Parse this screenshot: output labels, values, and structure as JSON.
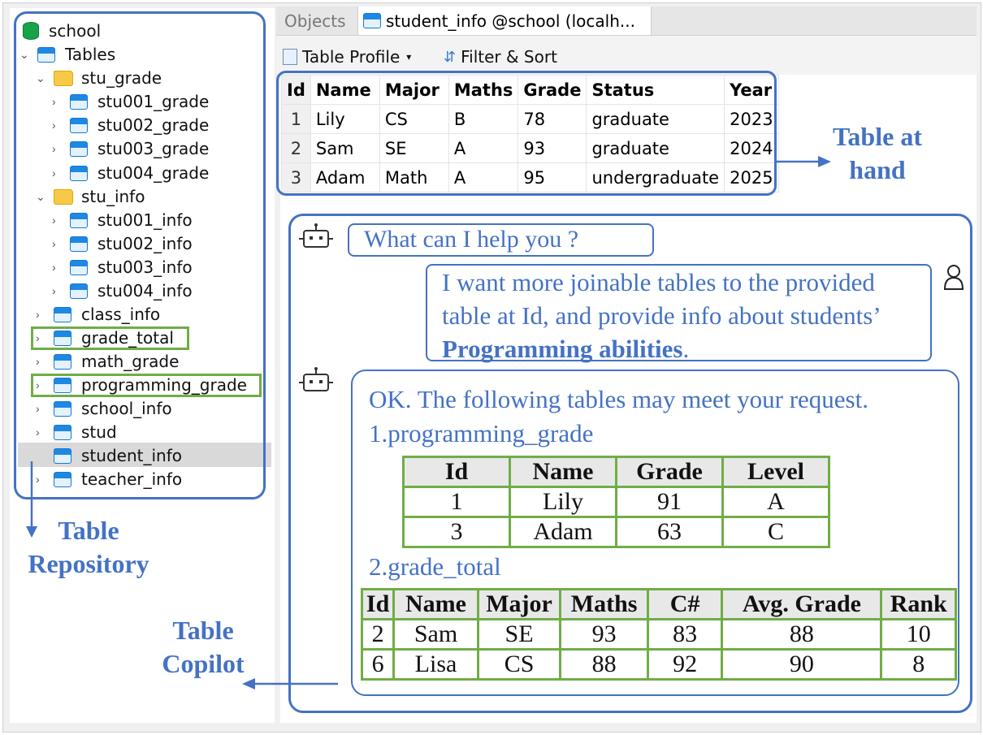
{
  "tree": {
    "root": "school",
    "tables_label": "Tables",
    "folders": [
      {
        "name": "stu_grade",
        "items": [
          "stu001_grade",
          "stu002_grade",
          "stu003_grade",
          "stu004_grade"
        ]
      },
      {
        "name": "stu_info",
        "items": [
          "stu001_info",
          "stu002_info",
          "stu003_info",
          "stu004_info"
        ]
      }
    ],
    "tables": [
      "class_info",
      "grade_total",
      "math_grade",
      "programming_grade",
      "school_info",
      "stud",
      "student_info",
      "teacher_info"
    ]
  },
  "tabs": {
    "objects": "Objects",
    "active": "student_info @school (localh..."
  },
  "toolbar": {
    "table_profile": "Table Profile",
    "filter_sort": "Filter & Sort"
  },
  "grid": {
    "columns": [
      "Id",
      "Name",
      "Major",
      "Maths",
      "Grade",
      "Status",
      "Year"
    ],
    "rows": [
      [
        "1",
        "Lily",
        "CS",
        "B",
        "78",
        "graduate",
        "2023"
      ],
      [
        "2",
        "Sam",
        "SE",
        "A",
        "93",
        "graduate",
        "2024"
      ],
      [
        "3",
        "Adam",
        "Math",
        "A",
        "95",
        "undergraduate",
        "2025"
      ]
    ]
  },
  "annotations": {
    "table_at_hand": [
      "Table at",
      "hand"
    ],
    "table_repository": [
      "Table",
      "Repository"
    ],
    "table_copilot": [
      "Table",
      "Copilot"
    ]
  },
  "chat": {
    "bot_greeting": "What can I help you ?",
    "user_msg_part1": "I want more joinable tables to the provided table at Id, and provide info about students’ ",
    "user_msg_bold": "Programming abilities",
    "user_msg_end": ".",
    "bot_reply": "OK. The following tables may meet your request.",
    "result1_title": "1.programming_grade",
    "result1": {
      "columns": [
        "Id",
        "Name",
        "Grade",
        "Level"
      ],
      "rows": [
        [
          "1",
          "Lily",
          "91",
          "A"
        ],
        [
          "3",
          "Adam",
          "63",
          "C"
        ]
      ]
    },
    "result2_title": "2.grade_total",
    "result2": {
      "columns": [
        "Id",
        "Name",
        "Major",
        "Maths",
        "C#",
        "Avg. Grade",
        "Rank"
      ],
      "rows": [
        [
          "2",
          "Sam",
          "SE",
          "93",
          "83",
          "88",
          "10"
        ],
        [
          "6",
          "Lisa",
          "CS",
          "88",
          "92",
          "90",
          "8"
        ]
      ]
    }
  },
  "colors": {
    "accent_blue": "#4472c4",
    "highlight_green": "#70ad47"
  }
}
